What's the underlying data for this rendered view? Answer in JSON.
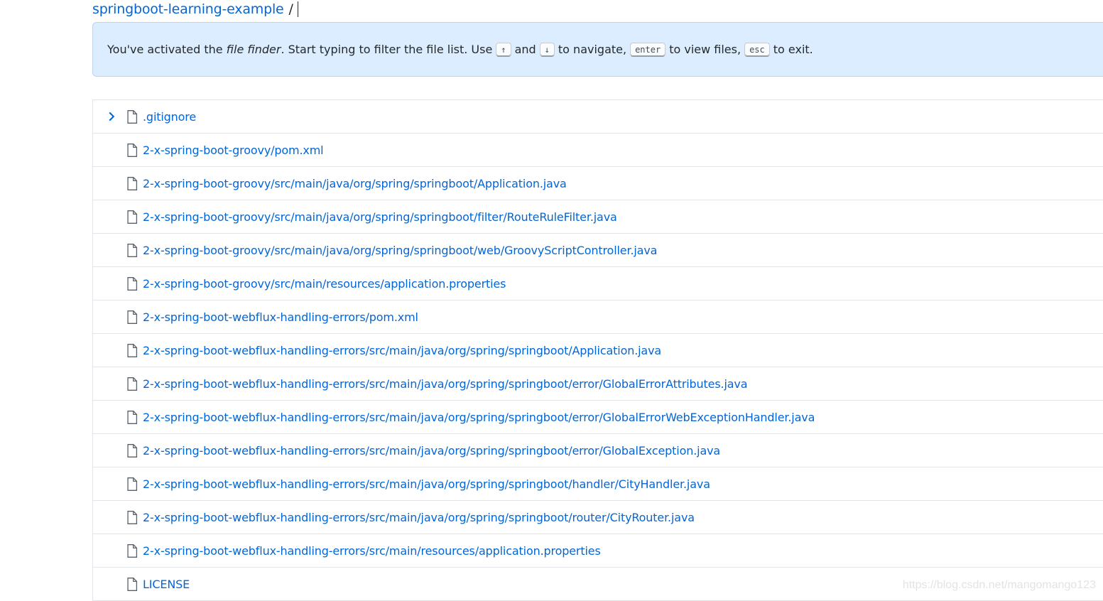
{
  "breadcrumb": {
    "repo": "springboot-learning-example",
    "separator": "/"
  },
  "flash": {
    "text_before": "You've activated the ",
    "emphasis": "file finder",
    "text_after_emphasis": ". Start typing to filter the file list. Use",
    "key_up": "↑",
    "text_and": "and",
    "key_down": "↓",
    "text_navigate": "to navigate,",
    "key_enter": "enter",
    "text_view": "to view files,",
    "key_esc": "esc",
    "text_exit": "to exit."
  },
  "files": [
    ".gitignore",
    "2-x-spring-boot-groovy/pom.xml",
    "2-x-spring-boot-groovy/src/main/java/org/spring/springboot/Application.java",
    "2-x-spring-boot-groovy/src/main/java/org/spring/springboot/filter/RouteRuleFilter.java",
    "2-x-spring-boot-groovy/src/main/java/org/spring/springboot/web/GroovyScriptController.java",
    "2-x-spring-boot-groovy/src/main/resources/application.properties",
    "2-x-spring-boot-webflux-handling-errors/pom.xml",
    "2-x-spring-boot-webflux-handling-errors/src/main/java/org/spring/springboot/Application.java",
    "2-x-spring-boot-webflux-handling-errors/src/main/java/org/spring/springboot/error/GlobalErrorAttributes.java",
    "2-x-spring-boot-webflux-handling-errors/src/main/java/org/spring/springboot/error/GlobalErrorWebExceptionHandler.java",
    "2-x-spring-boot-webflux-handling-errors/src/main/java/org/spring/springboot/error/GlobalException.java",
    "2-x-spring-boot-webflux-handling-errors/src/main/java/org/spring/springboot/handler/CityHandler.java",
    "2-x-spring-boot-webflux-handling-errors/src/main/java/org/spring/springboot/router/CityRouter.java",
    "2-x-spring-boot-webflux-handling-errors/src/main/resources/application.properties",
    "LICENSE"
  ],
  "selected_index": 0,
  "watermark": "https://blog.csdn.net/mangomango123",
  "colors": {
    "link": "#0366d6",
    "flash_bg": "#dbedff",
    "border": "#e1e4e8"
  }
}
